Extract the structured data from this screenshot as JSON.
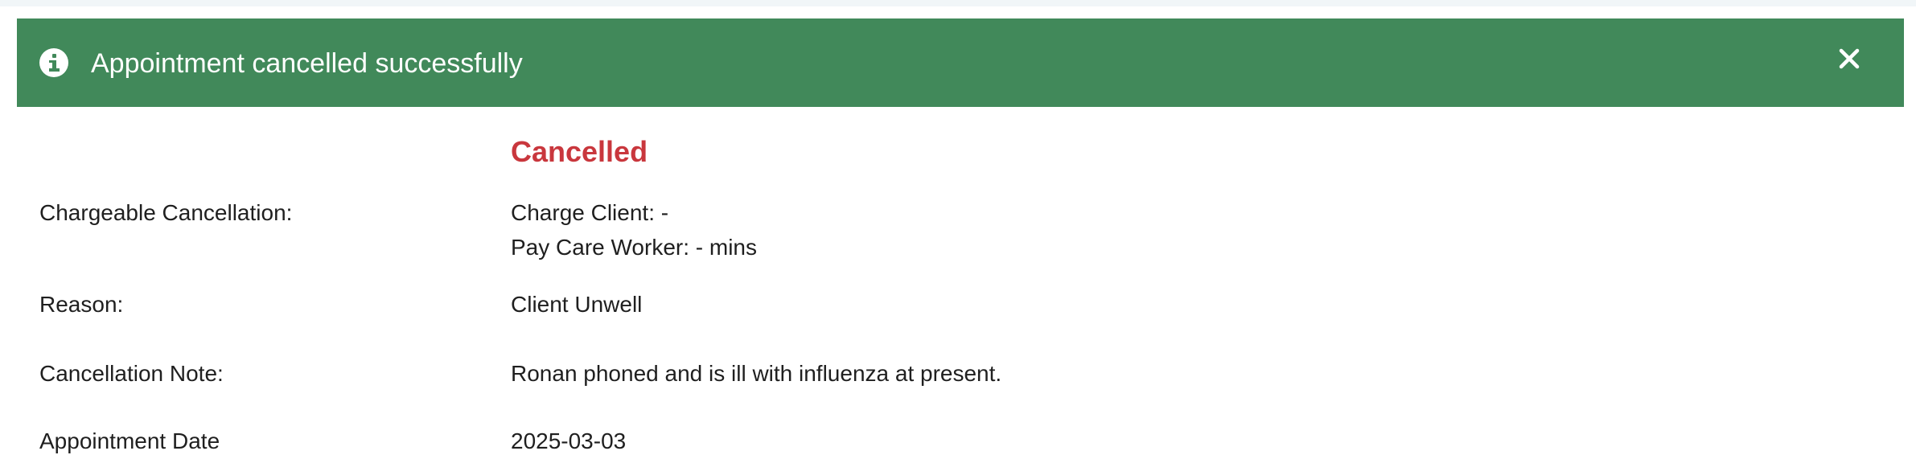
{
  "alert": {
    "message": "Appointment cancelled successfully",
    "icon": "info-icon",
    "close_icon": "close-icon",
    "color": "#41895a"
  },
  "status": {
    "text": "Cancelled",
    "color": "#c9373d"
  },
  "details": {
    "chargeable": {
      "label": "Chargeable Cancellation:",
      "charge_client": "Charge Client: -",
      "pay_care_worker": "Pay Care Worker: - mins"
    },
    "reason": {
      "label": "Reason:",
      "value": "Client Unwell"
    },
    "note": {
      "label": "Cancellation Note:",
      "value": "Ronan phoned and is ill with influenza at present."
    },
    "appointment_date": {
      "label": "Appointment Date",
      "value": "2025-03-03"
    }
  }
}
